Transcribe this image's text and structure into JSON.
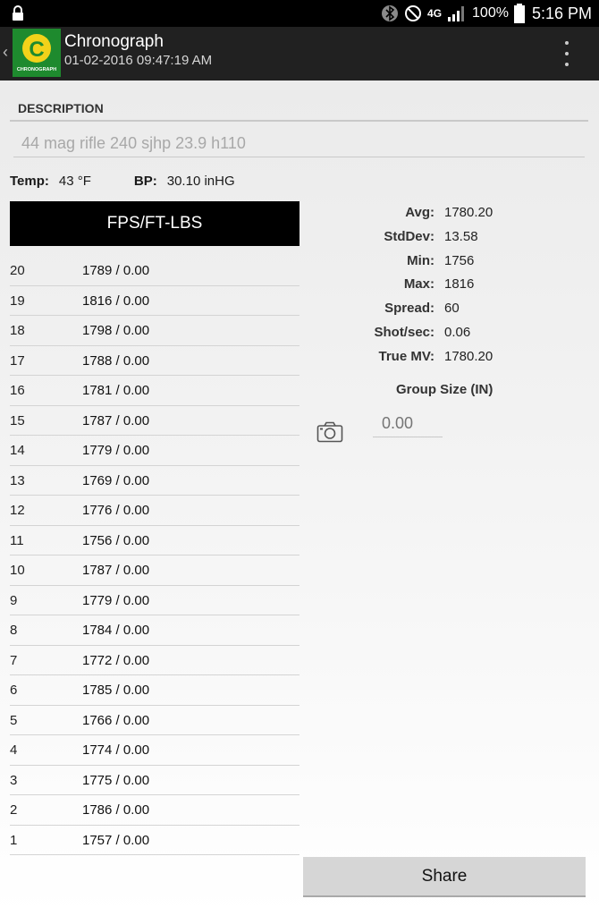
{
  "status_bar": {
    "network": "4G",
    "battery": "100%",
    "time": "5:16 PM"
  },
  "app_bar": {
    "title": "Chronograph",
    "subtitle": "01-02-2016 09:47:19 AM",
    "logo_text": "CHRONOGRAPH"
  },
  "description": {
    "label": "DESCRIPTION",
    "value": "44 mag rifle 240 sjhp 23.9 h110"
  },
  "conditions": {
    "temp_label": "Temp:",
    "temp_value": "43 °F",
    "bp_label": "BP:",
    "bp_value": "30.10 inHG"
  },
  "shots_header": "FPS/FT-LBS",
  "shots": [
    {
      "num": "20",
      "value": "1789 / 0.00"
    },
    {
      "num": "19",
      "value": "1816 / 0.00"
    },
    {
      "num": "18",
      "value": "1798 / 0.00"
    },
    {
      "num": "17",
      "value": "1788 / 0.00"
    },
    {
      "num": "16",
      "value": "1781 / 0.00"
    },
    {
      "num": "15",
      "value": "1787 / 0.00"
    },
    {
      "num": "14",
      "value": "1779 / 0.00"
    },
    {
      "num": "13",
      "value": "1769 / 0.00"
    },
    {
      "num": "12",
      "value": "1776 / 0.00"
    },
    {
      "num": "11",
      "value": "1756 / 0.00"
    },
    {
      "num": "10",
      "value": "1787 / 0.00"
    },
    {
      "num": "9",
      "value": "1779 / 0.00"
    },
    {
      "num": "8",
      "value": "1784 / 0.00"
    },
    {
      "num": "7",
      "value": "1772 / 0.00"
    },
    {
      "num": "6",
      "value": "1785 / 0.00"
    },
    {
      "num": "5",
      "value": "1766 / 0.00"
    },
    {
      "num": "4",
      "value": "1774 / 0.00"
    },
    {
      "num": "3",
      "value": "1775 / 0.00"
    },
    {
      "num": "2",
      "value": "1786 / 0.00"
    },
    {
      "num": "1",
      "value": "1757 / 0.00"
    }
  ],
  "stats": [
    {
      "label": "Avg:",
      "value": "1780.20"
    },
    {
      "label": "StdDev:",
      "value": "13.58"
    },
    {
      "label": "Min:",
      "value": "1756"
    },
    {
      "label": "Max:",
      "value": "1816"
    },
    {
      "label": "Spread:",
      "value": "60"
    },
    {
      "label": "Shot/sec:",
      "value": "0.06"
    },
    {
      "label": "True MV:",
      "value": "1780.20"
    }
  ],
  "group_size": {
    "title": "Group Size (IN)",
    "placeholder": "0.00"
  },
  "share_label": "Share",
  "colors": {
    "app_bar": "#212121",
    "status_bar": "#000000",
    "logo_green": "#1e8a2e",
    "logo_yellow": "#f2d21a"
  }
}
